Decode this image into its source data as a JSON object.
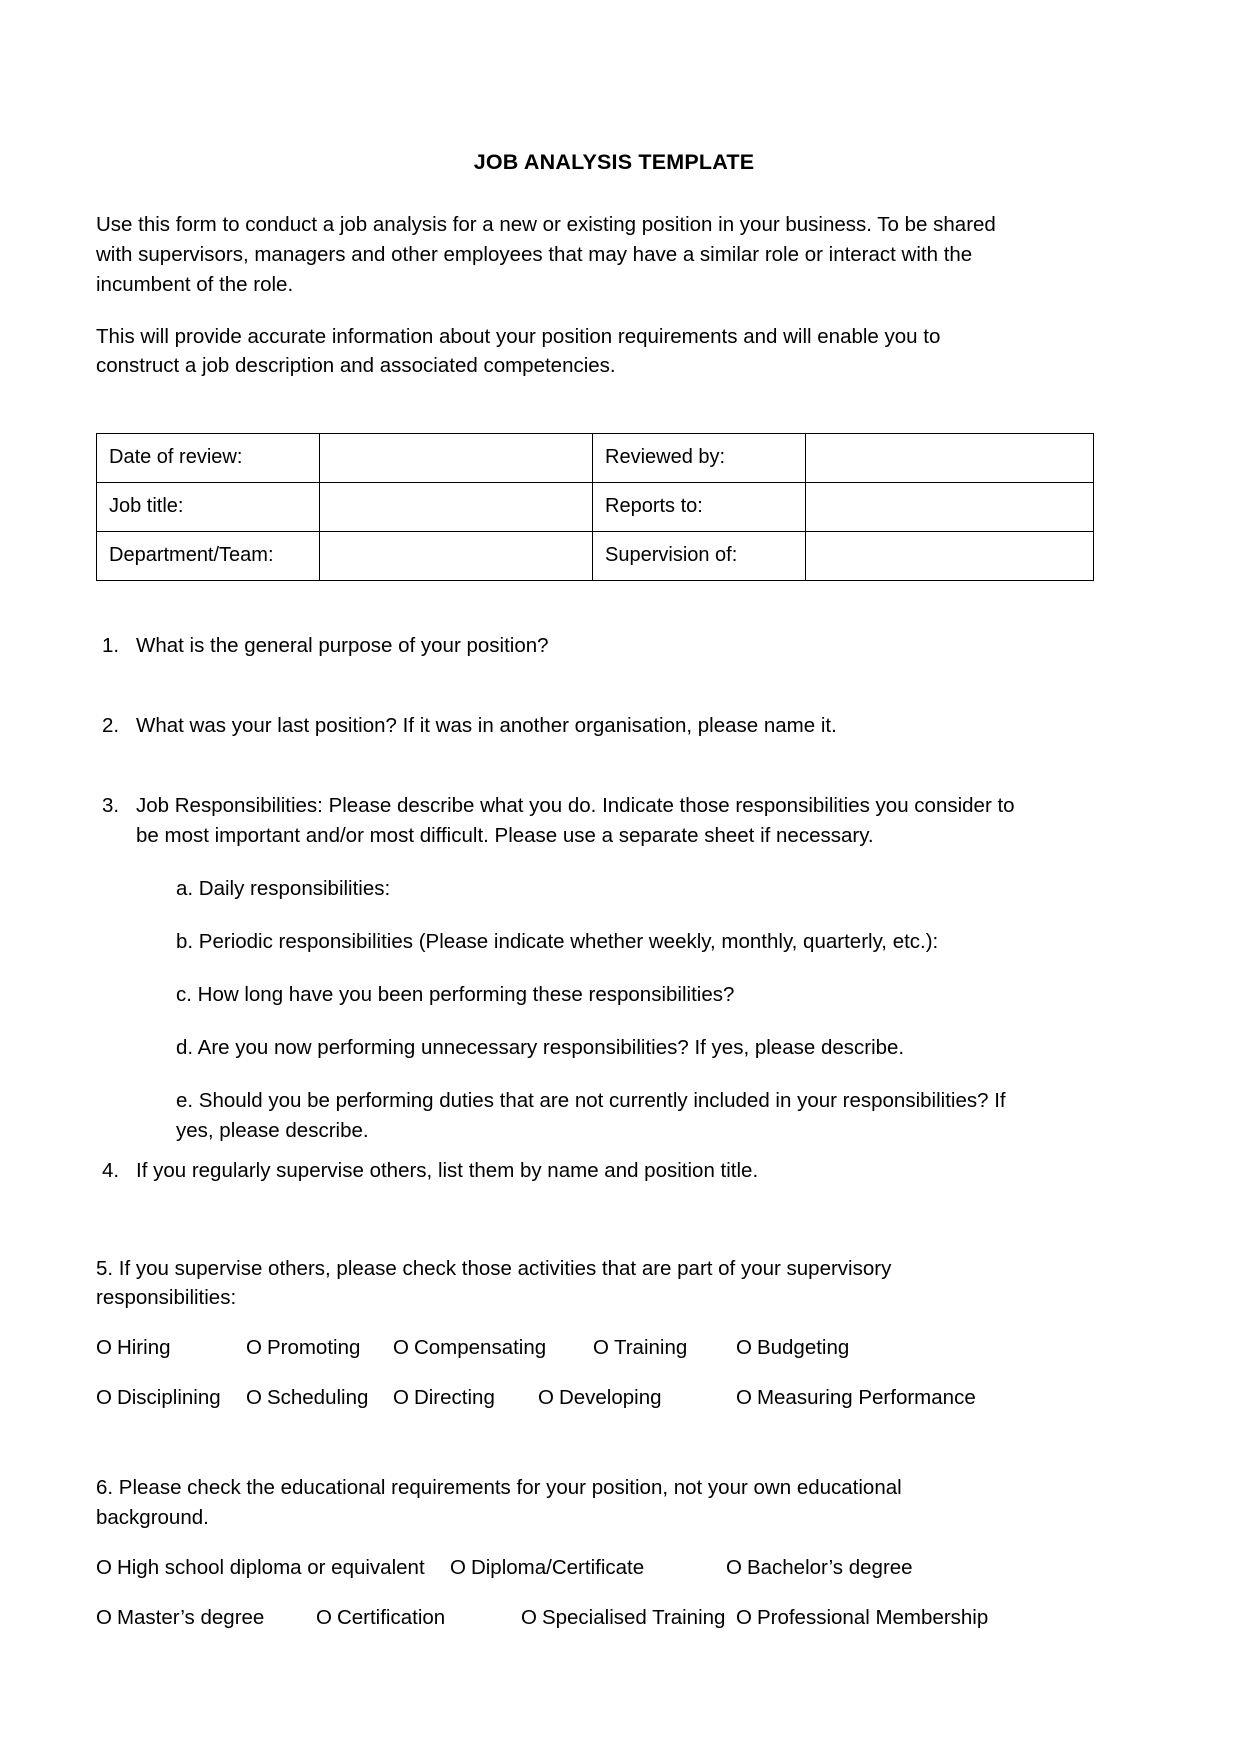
{
  "document": {
    "title": "JOB ANALYSIS TEMPLATE",
    "intro_paragraph_1": "Use this form to conduct a job analysis for a new or existing position in your business.  To be shared with supervisors, managers and other employees that may have a similar role or interact with the incumbent of the role.",
    "intro_paragraph_2": "This will provide accurate information about your position requirements and will enable you to construct a job description and associated competencies."
  },
  "info_table": {
    "rows": [
      {
        "label_a": "Date of review:",
        "value_a": "",
        "label_b": "Reviewed by:",
        "value_b": ""
      },
      {
        "label_a": "Job title:",
        "value_a": "",
        "label_b": "Reports to:",
        "value_b": ""
      },
      {
        "label_a": "Department/Team:",
        "value_a": "",
        "label_b": "Supervision of:",
        "value_b": ""
      }
    ]
  },
  "questions": {
    "q1": {
      "number": "1.",
      "text": "What is the general purpose of your position?"
    },
    "q2": {
      "number": "2.",
      "text": "What was your last position? If it was in another organisation, please name it."
    },
    "q3": {
      "number": "3.",
      "text": "Job Responsibilities: Please describe what you do. Indicate those responsibilities you consider to be most important and/or most difficult. Please use a separate sheet if necessary.",
      "sub_items": [
        "a. Daily responsibilities:",
        "b. Periodic responsibilities (Please indicate whether weekly, monthly, quarterly, etc.):",
        "c. How long have you been performing these responsibilities?",
        "d. Are you now performing unnecessary responsibilities? If yes, please describe.",
        "e. Should you be performing duties that are not currently included in your responsibilities? If yes, please describe."
      ]
    },
    "q4": {
      "number": "4.",
      "text": "If you regularly supervise others, list them by name and position title."
    },
    "q5": {
      "intro": "5. If you supervise others, please check those activities that are part of your supervisory responsibilities:",
      "checkbox_glyph": "O",
      "row1": [
        "Hiring",
        "Promoting",
        "Compensating",
        "Training",
        "Budgeting"
      ],
      "row2": [
        "Disciplining",
        "Scheduling",
        "Directing",
        "Developing",
        "Measuring Performance"
      ]
    },
    "q6": {
      "intro": "6. Please check the educational requirements for your position, not your own educational background.",
      "checkbox_glyph": "O",
      "row1": [
        "High school diploma or equivalent",
        "Diploma/Certificate",
        "Bachelor’s degree"
      ],
      "row2": [
        "Master’s degree",
        "Certification",
        "Specialised Training",
        "Professional Membership"
      ]
    }
  }
}
